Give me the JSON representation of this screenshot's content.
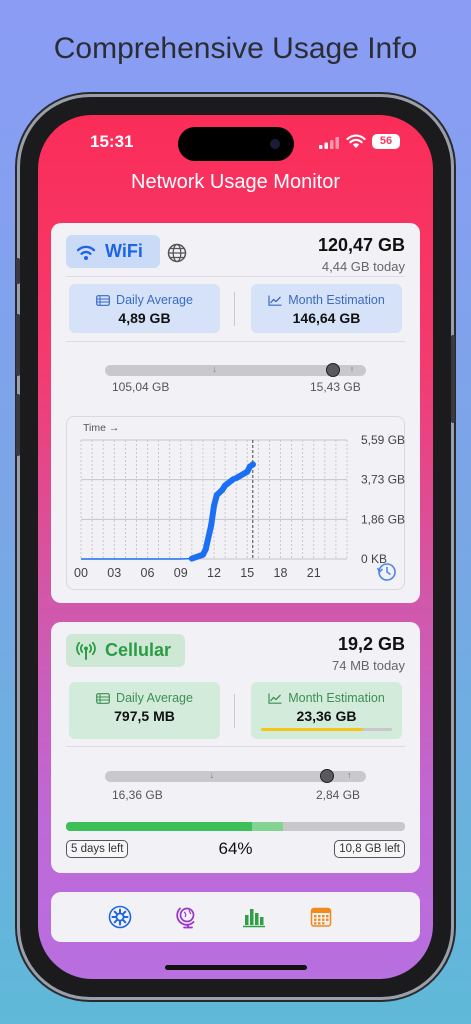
{
  "promo_title": "Comprehensive Usage Info",
  "status": {
    "time": "15:31",
    "battery": "56"
  },
  "app_title": "Network Usage Monitor",
  "wifi": {
    "label": "WiFi",
    "total": "120,47 GB",
    "today": "4,44 GB today",
    "daily_avg_label": "Daily Average",
    "daily_avg_value": "4,89 GB",
    "month_est_label": "Month Estimation",
    "month_est_value": "146,64 GB",
    "download": "105,04 GB",
    "upload": "15,43 GB",
    "download_share": 0.872
  },
  "chart_data": {
    "type": "line",
    "xlabel": "Time →",
    "ylabel": "",
    "x_ticks": [
      "00",
      "03",
      "06",
      "09",
      "12",
      "15",
      "18",
      "21"
    ],
    "y_ticks": [
      "0 KB",
      "1,86 GB",
      "3,73 GB",
      "5,59 GB"
    ],
    "ylim": [
      0,
      5.59
    ],
    "xlim": [
      0,
      24
    ],
    "current_hour": 15.5,
    "grid": true,
    "series": [
      {
        "values": [
          [
            0,
            0
          ],
          [
            1,
            0
          ],
          [
            2,
            0
          ],
          [
            3,
            0
          ],
          [
            4,
            0
          ],
          [
            5,
            0
          ],
          [
            6,
            0
          ],
          [
            7,
            0
          ],
          [
            8,
            0
          ],
          [
            9,
            0
          ],
          [
            10,
            0.02
          ],
          [
            11.0,
            0.2
          ],
          [
            11.25,
            0.45
          ],
          [
            11.75,
            1.6
          ],
          [
            12.0,
            2.5
          ],
          [
            12.25,
            3.0
          ],
          [
            12.75,
            3.25
          ],
          [
            13.0,
            3.45
          ],
          [
            13.75,
            3.75
          ],
          [
            14.0,
            3.8
          ],
          [
            15.0,
            4.1
          ],
          [
            15.25,
            4.35
          ],
          [
            15.5,
            4.44
          ]
        ]
      }
    ]
  },
  "cellular": {
    "label": "Cellular",
    "total": "19,2 GB",
    "today": "74 MB today",
    "daily_avg_label": "Daily Average",
    "daily_avg_value": "797,5 MB",
    "month_est_label": "Month Estimation",
    "month_est_value": "23,36 GB",
    "month_est_fill": 0.78,
    "download": "16,36 GB",
    "upload": "2,84 GB",
    "download_share": 0.852,
    "days_left": "5 days left",
    "percent": "64%",
    "percent_value": 0.64,
    "time_progress": 0.55,
    "remaining": "10,8 GB left"
  },
  "tabs": [
    {
      "name": "settings-icon",
      "color": "#1f63e6"
    },
    {
      "name": "globe-icon",
      "color": "#9b35c9"
    },
    {
      "name": "bar-chart-icon",
      "color": "#2f9e45"
    },
    {
      "name": "calendar-icon",
      "color": "#f08a1c"
    }
  ]
}
